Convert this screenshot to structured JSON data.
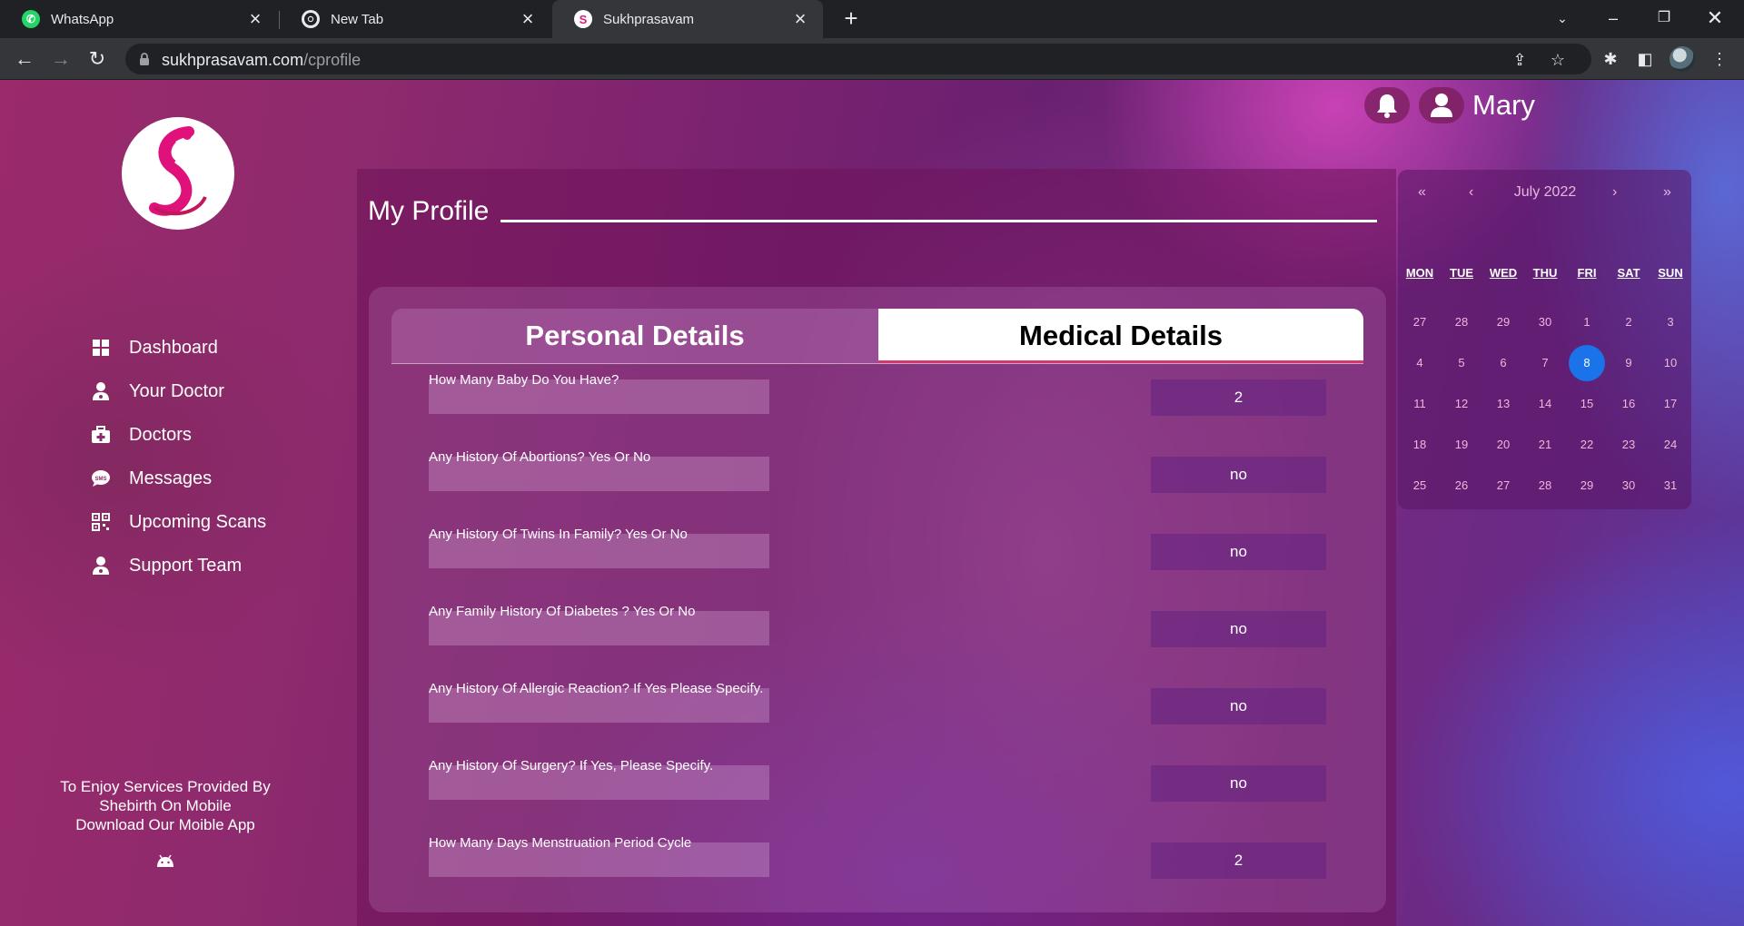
{
  "browser": {
    "tabs": [
      {
        "title": "WhatsApp",
        "icon": "whatsapp-icon"
      },
      {
        "title": "New Tab",
        "icon": "chrome-icon"
      },
      {
        "title": "Sukhprasavam",
        "icon": "sukhprasavam-icon"
      }
    ],
    "url_domain": "sukhprasavam.com",
    "url_path": "/cprofile"
  },
  "header": {
    "username": "Mary"
  },
  "sidebar": {
    "items": [
      {
        "label": "Dashboard",
        "icon": "grid-icon"
      },
      {
        "label": "Your Doctor",
        "icon": "doctor-icon"
      },
      {
        "label": "Doctors",
        "icon": "medical-kit-icon"
      },
      {
        "label": "Messages",
        "icon": "sms-icon"
      },
      {
        "label": "Upcoming Scans",
        "icon": "qr-icon"
      },
      {
        "label": "Support Team",
        "icon": "support-icon"
      }
    ],
    "promo_line1": "To Enjoy Services Provided By",
    "promo_line2": "Shebirth On Mobile",
    "promo_line3": "Download Our Moible App"
  },
  "main": {
    "title": "My Profile",
    "tabs": {
      "personal": "Personal Details",
      "medical": "Medical Details"
    },
    "questions": [
      {
        "q": "How Many Baby Do You Have?",
        "a": "2"
      },
      {
        "q": "Any History Of Abortions? Yes Or No",
        "a": "no"
      },
      {
        "q": "Any History Of Twins In Family? Yes Or No",
        "a": "no"
      },
      {
        "q": "Any Family History Of Diabetes ? Yes Or No",
        "a": "no"
      },
      {
        "q": "Any History Of Allergic Reaction? If Yes Please Specify.",
        "a": "no"
      },
      {
        "q": "Any History Of Surgery? If Yes, Please Specify.",
        "a": "no"
      },
      {
        "q": "How Many Days Menstruation Period Cycle",
        "a": "2"
      }
    ]
  },
  "calendar": {
    "prev_year": "«",
    "prev_month": "‹",
    "month_label": "July 2022",
    "next_month": "›",
    "next_year": "»",
    "weekdays": [
      "MON",
      "TUE",
      "WED",
      "THU",
      "FRI",
      "SAT",
      "SUN"
    ],
    "weeks": [
      [
        "27",
        "28",
        "29",
        "30",
        "1",
        "2",
        "3"
      ],
      [
        "4",
        "5",
        "6",
        "7",
        "8",
        "9",
        "10"
      ],
      [
        "11",
        "12",
        "13",
        "14",
        "15",
        "16",
        "17"
      ],
      [
        "18",
        "19",
        "20",
        "21",
        "22",
        "23",
        "24"
      ],
      [
        "25",
        "26",
        "27",
        "28",
        "29",
        "30",
        "31"
      ]
    ],
    "selected": "8",
    "selected_color": "#1a73e8"
  }
}
